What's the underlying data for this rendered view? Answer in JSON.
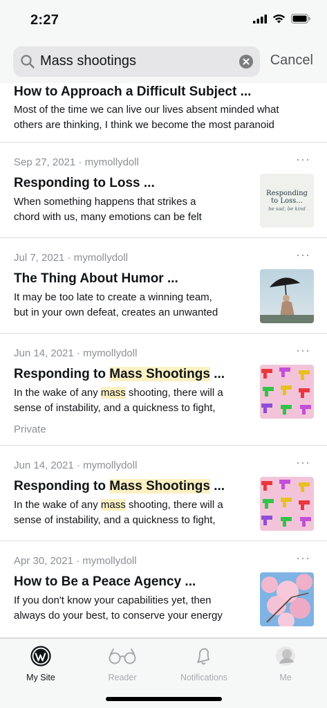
{
  "status": {
    "time": "2:27"
  },
  "search": {
    "query": "Mass shootings",
    "cancel_label": "Cancel"
  },
  "posts": [
    {
      "title": "How to Approach a Difficult Subject ...",
      "excerpt_lines": [
        "Most of the time we can live our lives absent minded what",
        "others are thinking, I think we become the most paranoid"
      ]
    },
    {
      "meta": "Sep 27, 2021 · mymollydoll",
      "title": "Responding to Loss ...",
      "excerpt_lines": [
        "When something happens that strikes a",
        "chord with us, many emotions can be felt"
      ],
      "thumb_text_1": "Responding",
      "thumb_text_2": "to Loss...",
      "thumb_text_3": "be sad, be kind"
    },
    {
      "meta": "Jul 7, 2021 · mymollydoll",
      "title": "The Thing About Humor ...",
      "excerpt_lines": [
        "It may be too late to create a winning team,",
        "but in your own defeat, creates an unwanted"
      ]
    },
    {
      "meta": "Jun 14, 2021 · mymollydoll",
      "title_pre": "Responding to ",
      "title_hl": "Mass Shootings",
      "title_post": " ...",
      "excerpt_1_pre": "In the wake of any ",
      "excerpt_1_hl": "mass",
      "excerpt_1_post": " shooting, there will a",
      "excerpt_2": "sense of instability, and a quickness to fight,",
      "tag": "Private"
    },
    {
      "meta": "Jun 14, 2021 · mymollydoll",
      "title_pre": "Responding to ",
      "title_hl": "Mass Shootings",
      "title_post": " ...",
      "excerpt_1_pre": "In the wake of any ",
      "excerpt_1_hl": "mass",
      "excerpt_1_post": " shooting, there will a",
      "excerpt_2": "sense of instability, and a quickness to fight,"
    },
    {
      "meta": "Apr 30, 2021 · mymollydoll",
      "title": "How to Be a Peace Agency ...",
      "excerpt_lines": [
        "If you don't know your capabilities yet, then",
        "always do your best, to conserve your energy"
      ]
    }
  ],
  "more_label": "···",
  "tabs": [
    {
      "label": "My Site",
      "icon": "wordpress-icon",
      "active": true
    },
    {
      "label": "Reader",
      "icon": "glasses-icon",
      "active": false
    },
    {
      "label": "Notifications",
      "icon": "bell-icon",
      "active": false
    },
    {
      "label": "Me",
      "icon": "avatar-icon",
      "active": false
    }
  ],
  "colors": {
    "highlight": "#fdf0c2",
    "meta_gray": "#8c8f94",
    "text": "#101517"
  }
}
